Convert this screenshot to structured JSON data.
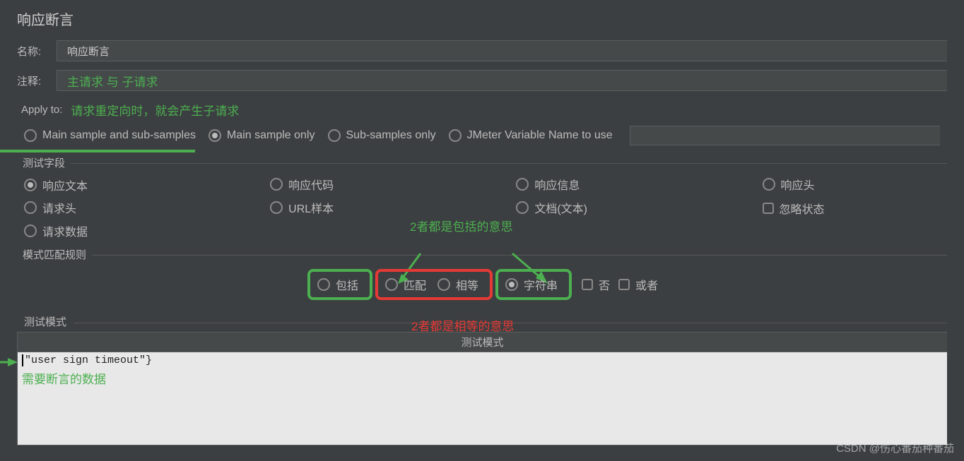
{
  "panel_title": "响应断言",
  "name": {
    "label": "名称:",
    "value": "响应断言"
  },
  "comment": {
    "label": "注释:",
    "value": "主请求 与 子请求"
  },
  "apply_to": {
    "label": "Apply to:",
    "annotation": "请求重定向时，就会产生子请求",
    "options": {
      "main_sub": "Main sample and sub-samples",
      "main_only": "Main sample only",
      "sub_only": "Sub-samples only",
      "jmeter_var": "JMeter Variable Name to use"
    },
    "selected": "main_only"
  },
  "test_fields": {
    "legend": "测试字段",
    "items": {
      "response_text": "响应文本",
      "response_code": "响应代码",
      "response_message": "响应信息",
      "response_headers": "响应头",
      "request_headers": "请求头",
      "url_sample": "URL样本",
      "document_text": "文档(文本)",
      "ignore_status": "忽略状态",
      "request_data": "请求数据"
    },
    "selected": "response_text"
  },
  "pattern_rules": {
    "legend": "模式匹配规则",
    "annot_top": "2者都是包括的意思",
    "annot_bottom": "2者都是相等的意思",
    "options": {
      "contains": "包括",
      "matches": "匹配",
      "equals": "相等",
      "substring": "字符串",
      "not": "否",
      "or": "或者"
    },
    "selected": "substring"
  },
  "test_pattern": {
    "legend": "测试模式",
    "header": "测试模式",
    "row1": "\"user sign timeout\"}",
    "annotation": "需要断言的数据"
  },
  "watermark": "CSDN @伤心番茄种番茄"
}
